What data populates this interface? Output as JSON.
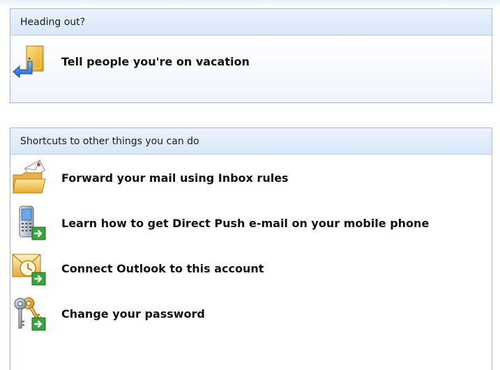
{
  "heading_section": {
    "title": "Heading out?",
    "items": [
      {
        "label": "Tell people you're on vacation",
        "icon": "vacation-door-arrow-icon"
      }
    ]
  },
  "shortcuts_section": {
    "title": "Shortcuts to other things you can do",
    "items": [
      {
        "label": "Forward your mail using Inbox rules",
        "icon": "folder-mail-icon"
      },
      {
        "label": "Learn how to get Direct Push e-mail on your mobile phone",
        "icon": "mobile-phone-icon"
      },
      {
        "label": "Connect Outlook to this account",
        "icon": "outlook-clock-icon"
      },
      {
        "label": "Change your password",
        "icon": "keys-icon"
      }
    ]
  },
  "colors": {
    "header_bg": "#dfeaf9",
    "panel_border": "#a9b8cc",
    "arrow_blue": "#2f6fd6",
    "badge_green": "#3aa33a"
  }
}
